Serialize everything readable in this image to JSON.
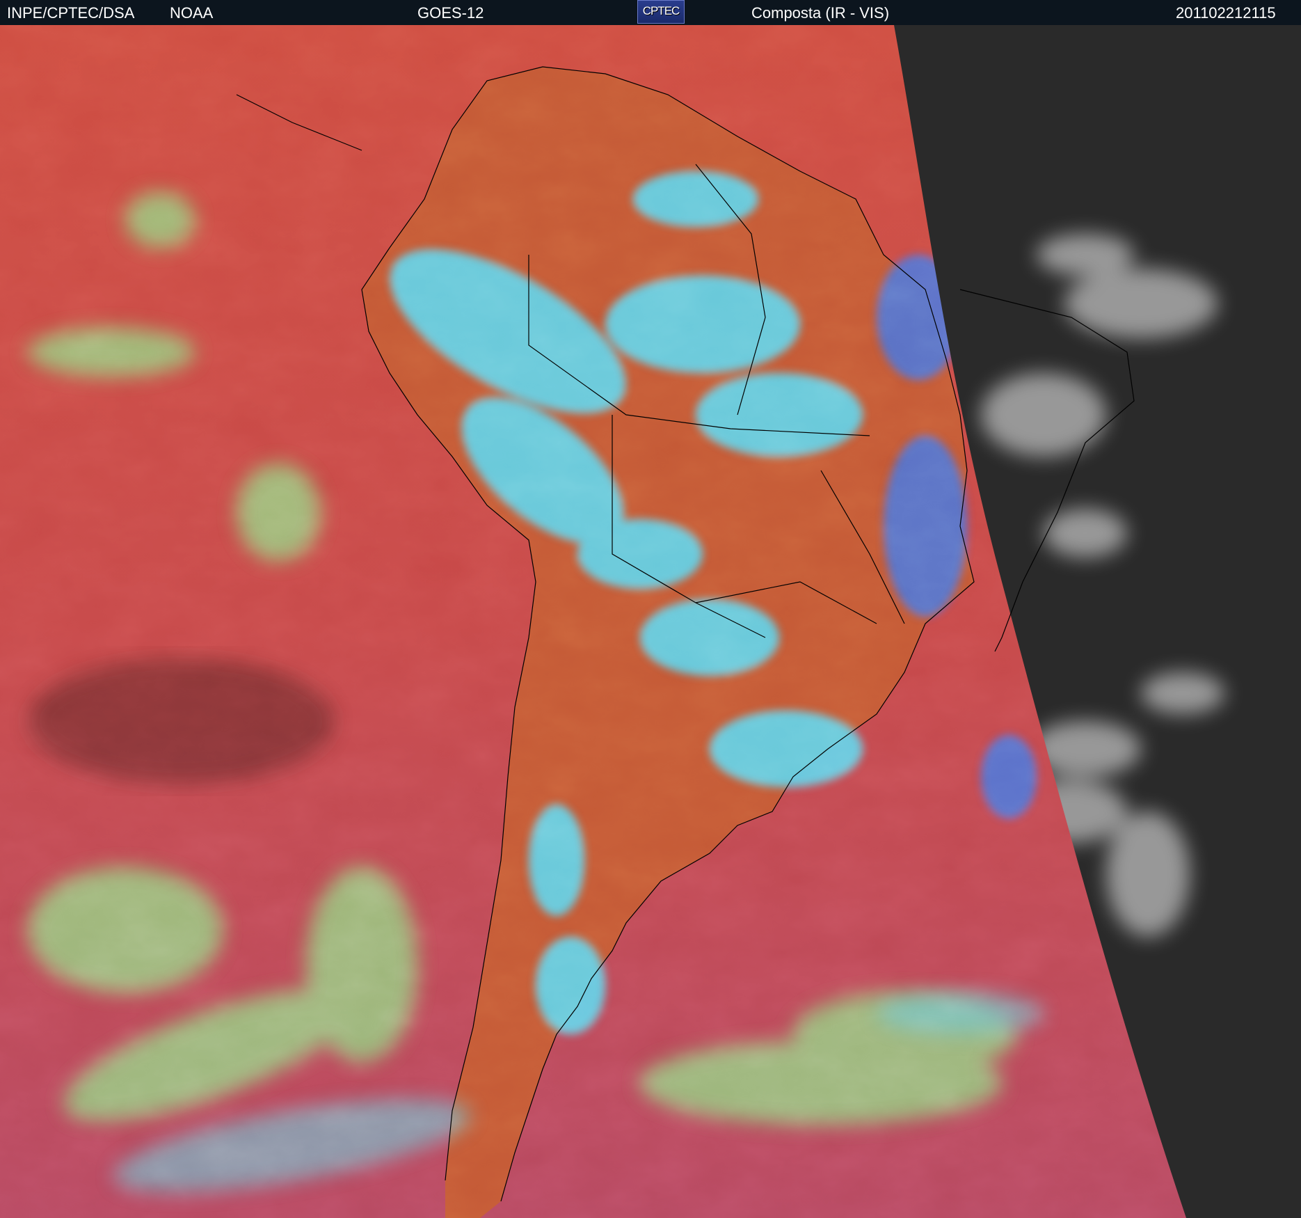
{
  "header": {
    "org": "INPE/CPTEC/DSA",
    "agency": "NOAA",
    "satellite": "GOES-12",
    "logo_text": "CPTEC",
    "product": "Composta (IR - VIS)",
    "timestamp": "201102212115"
  },
  "colors": {
    "header_bg": "#0c151e",
    "ocean_ir": "#c8504a",
    "land_ir": "#c85a38",
    "high_cloud": "#60d8f0",
    "mid_cloud": "#8ee090",
    "deep_convection": "#4a7ae0",
    "visible_night_side": "#2c2c2c",
    "visible_cloud": "#d0d0d0",
    "coastline": "#000000"
  }
}
